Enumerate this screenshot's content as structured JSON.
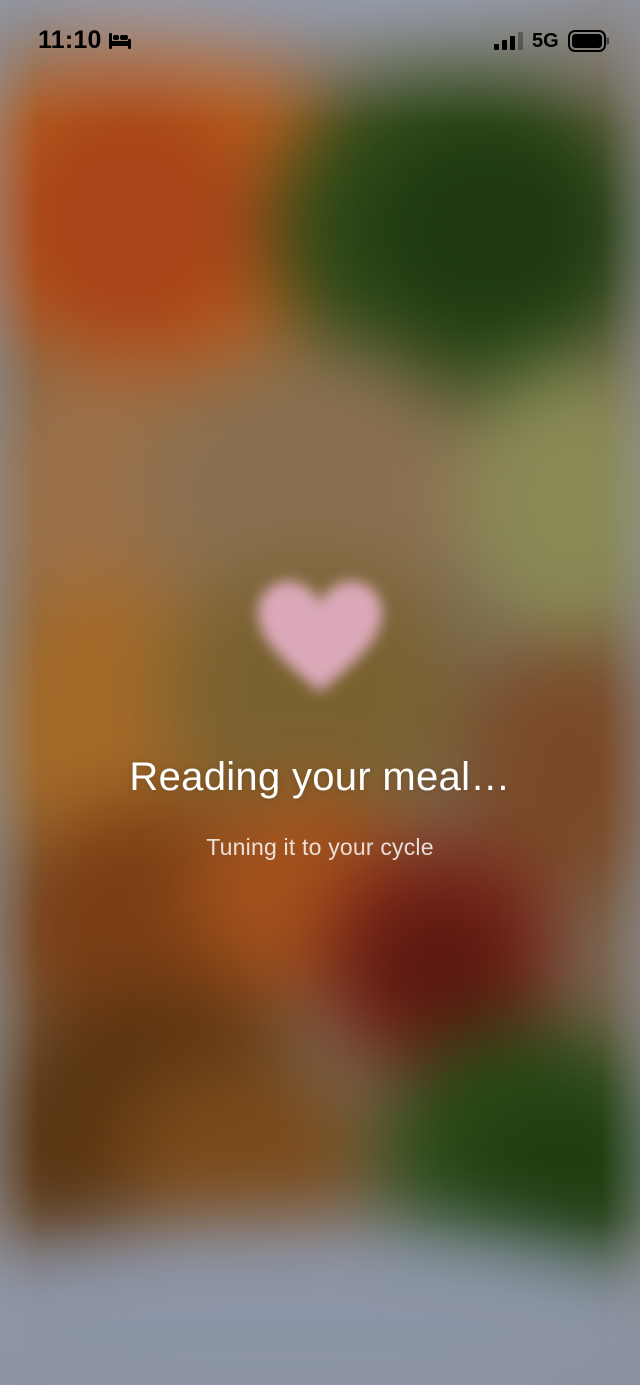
{
  "status_bar": {
    "time": "11:10",
    "network": "5G",
    "icons": [
      "bed-icon",
      "signal-icon",
      "battery-icon"
    ]
  },
  "loading": {
    "icon": "heart-icon",
    "title": "Reading your meal…",
    "subtitle": "Tuning it to your cycle"
  },
  "colors": {
    "heart": "#d9a7b8",
    "title": "#ffffff",
    "subtitle": "#eef0ee"
  }
}
